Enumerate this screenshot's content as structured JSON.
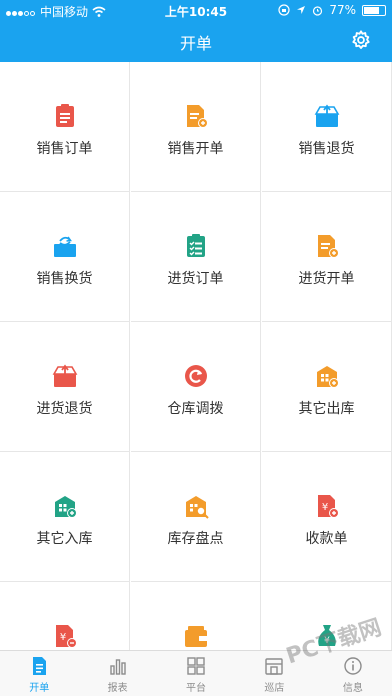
{
  "status": {
    "carrier": "中国移动",
    "time": "上午10:45",
    "battery": "77%",
    "battery_level": 0.77
  },
  "header": {
    "title": "开单"
  },
  "grid": [
    {
      "label": "销售订单",
      "icon": "clipboard-icon",
      "color": "#e9564a"
    },
    {
      "label": "销售开单",
      "icon": "doc-plus-icon",
      "color": "#f39c2b"
    },
    {
      "label": "销售退货",
      "icon": "tray-return-icon",
      "color": "#1aa3ef"
    },
    {
      "label": "销售换货",
      "icon": "tray-exchange-icon",
      "color": "#1aa3ef"
    },
    {
      "label": "进货订单",
      "icon": "checklist-icon",
      "color": "#22a386"
    },
    {
      "label": "进货开单",
      "icon": "doc-plus-icon",
      "color": "#f39c2b"
    },
    {
      "label": "进货退货",
      "icon": "tray-return-icon",
      "color": "#e9564a"
    },
    {
      "label": "仓库调拨",
      "icon": "refresh-icon",
      "color": "#e9564a"
    },
    {
      "label": "其它出库",
      "icon": "warehouse-out-icon",
      "color": "#f39c2b"
    },
    {
      "label": "其它入库",
      "icon": "warehouse-in-icon",
      "color": "#22a386"
    },
    {
      "label": "库存盘点",
      "icon": "warehouse-search-icon",
      "color": "#f39c2b"
    },
    {
      "label": "收款单",
      "icon": "yuan-doc-plus-icon",
      "color": "#e9564a"
    },
    {
      "label": "",
      "icon": "yuan-doc-minus-icon",
      "color": "#e9564a"
    },
    {
      "label": "",
      "icon": "wallet-icon",
      "color": "#f39c2b"
    },
    {
      "label": "",
      "icon": "money-bag-icon",
      "color": "#22a386"
    }
  ],
  "tabs": [
    {
      "label": "开单",
      "icon": "document-icon",
      "active": true
    },
    {
      "label": "报表",
      "icon": "bar-chart-icon",
      "active": false
    },
    {
      "label": "平台",
      "icon": "grid-icon",
      "active": false
    },
    {
      "label": "巡店",
      "icon": "store-icon",
      "active": false
    },
    {
      "label": "信息",
      "icon": "info-icon",
      "active": false
    }
  ],
  "watermark": "PC下载网"
}
